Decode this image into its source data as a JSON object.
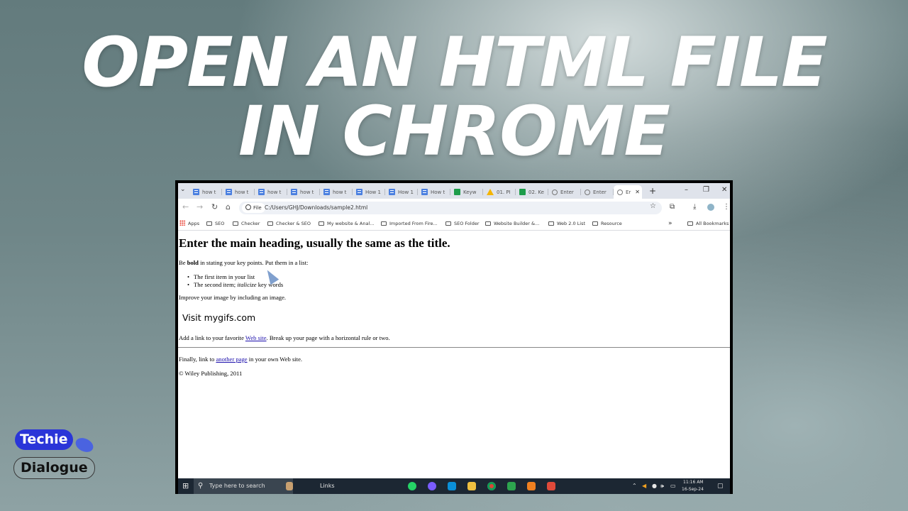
{
  "headline": {
    "line1": "OPEN AN HTML FILE",
    "line2": "IN CHROME"
  },
  "browser": {
    "tabs": [
      {
        "label": "how t",
        "icon": "docs-icon"
      },
      {
        "label": "how t",
        "icon": "docs-icon"
      },
      {
        "label": "how t",
        "icon": "docs-icon"
      },
      {
        "label": "how t",
        "icon": "docs-icon"
      },
      {
        "label": "how t",
        "icon": "docs-icon"
      },
      {
        "label": "How 1",
        "icon": "docs-icon"
      },
      {
        "label": "How 1",
        "icon": "docs-icon"
      },
      {
        "label": "How t",
        "icon": "docs-icon"
      },
      {
        "label": "Keyw",
        "icon": "sheets-icon"
      },
      {
        "label": "01. PI",
        "icon": "drive-icon"
      },
      {
        "label": "02. Ke",
        "icon": "sheets-icon"
      },
      {
        "label": "Enter",
        "icon": "globe-icon"
      },
      {
        "label": "Enter",
        "icon": "globe-icon"
      },
      {
        "label": "Er",
        "icon": "globe-icon",
        "active": true
      }
    ],
    "new_tab": "+",
    "window_controls": {
      "minimize": "–",
      "restore": "❐",
      "close": "✕"
    },
    "chip_label": "File",
    "url": "C:/Users/GHJ/Downloads/sample2.html",
    "bookmarks": [
      "Apps",
      "SEO",
      "Checker",
      "Checker & SEO",
      "My website & Anal...",
      "Imported From Fire...",
      "SEO Folder",
      "Website Builder &...",
      "Web 2.0 List",
      "Resource"
    ],
    "bookmarks_overflow": "»",
    "all_bookmarks": "All Bookmarks"
  },
  "webpage": {
    "heading": "Enter the main heading, usually the same as the title.",
    "para1_pre": "Be ",
    "para1_bold": "bold",
    "para1_post": " in stating your key points. Put them in a list:",
    "list_item1": "The first item in your list",
    "list_item2_pre": "The second item; ",
    "list_item2_italic": "italicize",
    "list_item2_post": " key words",
    "para2": "Improve your image by including an image.",
    "visit": "Visit mygifs.com",
    "para3_pre": "Add a link to your favorite ",
    "para3_link": "Web site",
    "para3_post": ". Break up your page with a horizontal rule or two.",
    "para4_pre": "Finally, link to ",
    "para4_link": "another page",
    "para4_post": " in your own Web site.",
    "copyright": "© Wiley Publishing, 2011"
  },
  "taskbar": {
    "search_placeholder": "Type here to search",
    "links_label": "Links",
    "time": "11:16 AM",
    "date": "16-Sep-24"
  },
  "logo": {
    "line1": "Techie",
    "line2": "Dialogue"
  },
  "colors": {
    "logo_blue": "#2a35d8",
    "link": "#1a0dab",
    "taskbar": "#1c2733"
  }
}
